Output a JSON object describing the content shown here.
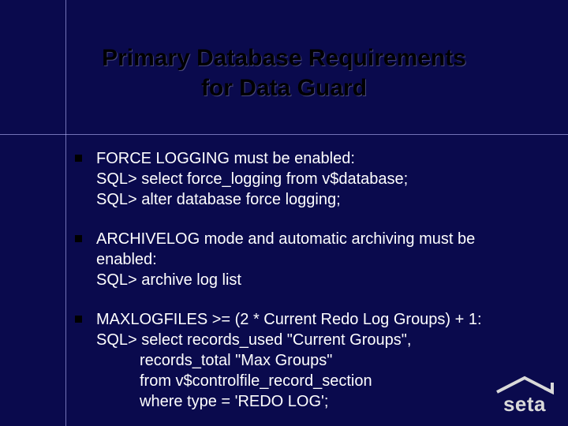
{
  "title_line1": "Primary Database Requirements",
  "title_line2": "for Data Guard",
  "bullets": [
    {
      "head": "FORCE LOGGING must be enabled:",
      "lines": [
        "SQL> select force_logging from v$database;",
        "SQL> alter database force logging;"
      ]
    },
    {
      "head": "ARCHIVELOG mode and automatic archiving must be enabled:",
      "lines": [
        "SQL> archive log list"
      ]
    },
    {
      "head": "MAXLOGFILES >= (2 * Current Redo Log Groups) + 1:",
      "lines": [
        "SQL> select records_used \"Current Groups\",",
        "records_total \"Max Groups\"",
        "from v$controlfile_record_section",
        "where type = 'REDO LOG';"
      ],
      "indentFrom": 1
    }
  ],
  "logo_text": "seta"
}
